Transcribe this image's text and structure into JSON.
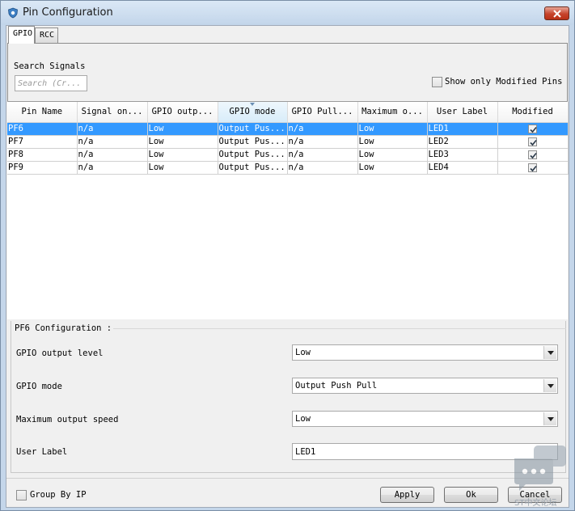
{
  "window": {
    "title": "Pin Configuration"
  },
  "tabs": [
    {
      "label": "GPIO",
      "active": true
    },
    {
      "label": "RCC",
      "active": false
    }
  ],
  "search": {
    "label": "Search Signals",
    "placeholder": "Search (Cr..."
  },
  "filter": {
    "show_modified_label": "Show only Modified Pins",
    "checked": false
  },
  "table": {
    "columns": [
      "Pin Name",
      "Signal on...",
      "GPIO outp...",
      "GPIO mode",
      "GPIO Pull...",
      "Maximum o...",
      "User Label",
      "Modified"
    ],
    "rows": [
      {
        "pin": "PF6",
        "signal": "n/a",
        "output": "Low",
        "mode": "Output Pus...",
        "pull": "n/a",
        "speed": "Low",
        "label": "LED1",
        "modified": true,
        "selected": true
      },
      {
        "pin": "PF7",
        "signal": "n/a",
        "output": "Low",
        "mode": "Output Pus...",
        "pull": "n/a",
        "speed": "Low",
        "label": "LED2",
        "modified": true,
        "selected": false
      },
      {
        "pin": "PF8",
        "signal": "n/a",
        "output": "Low",
        "mode": "Output Pus...",
        "pull": "n/a",
        "speed": "Low",
        "label": "LED3",
        "modified": true,
        "selected": false
      },
      {
        "pin": "PF9",
        "signal": "n/a",
        "output": "Low",
        "mode": "Output Pus...",
        "pull": "n/a",
        "speed": "Low",
        "label": "LED4",
        "modified": true,
        "selected": false
      }
    ]
  },
  "config": {
    "title": "PF6 Configuration :",
    "output_level": {
      "label": "GPIO output level",
      "value": "Low"
    },
    "mode": {
      "label": "GPIO mode",
      "value": "Output Push Pull"
    },
    "speed": {
      "label": "Maximum output speed",
      "value": "Low"
    },
    "user_label": {
      "label": "User Label",
      "value": "LED1"
    }
  },
  "footer": {
    "group_by_ip_label": "Group By IP",
    "apply_label": "Apply",
    "ok_label": "Ok",
    "cancel_label": "Cancel"
  },
  "watermark": {
    "text": "ST中文论坛"
  },
  "colors": {
    "selection": "#3399ff",
    "close_button": "#c6442c",
    "title_bar": "#c2d5ea"
  }
}
